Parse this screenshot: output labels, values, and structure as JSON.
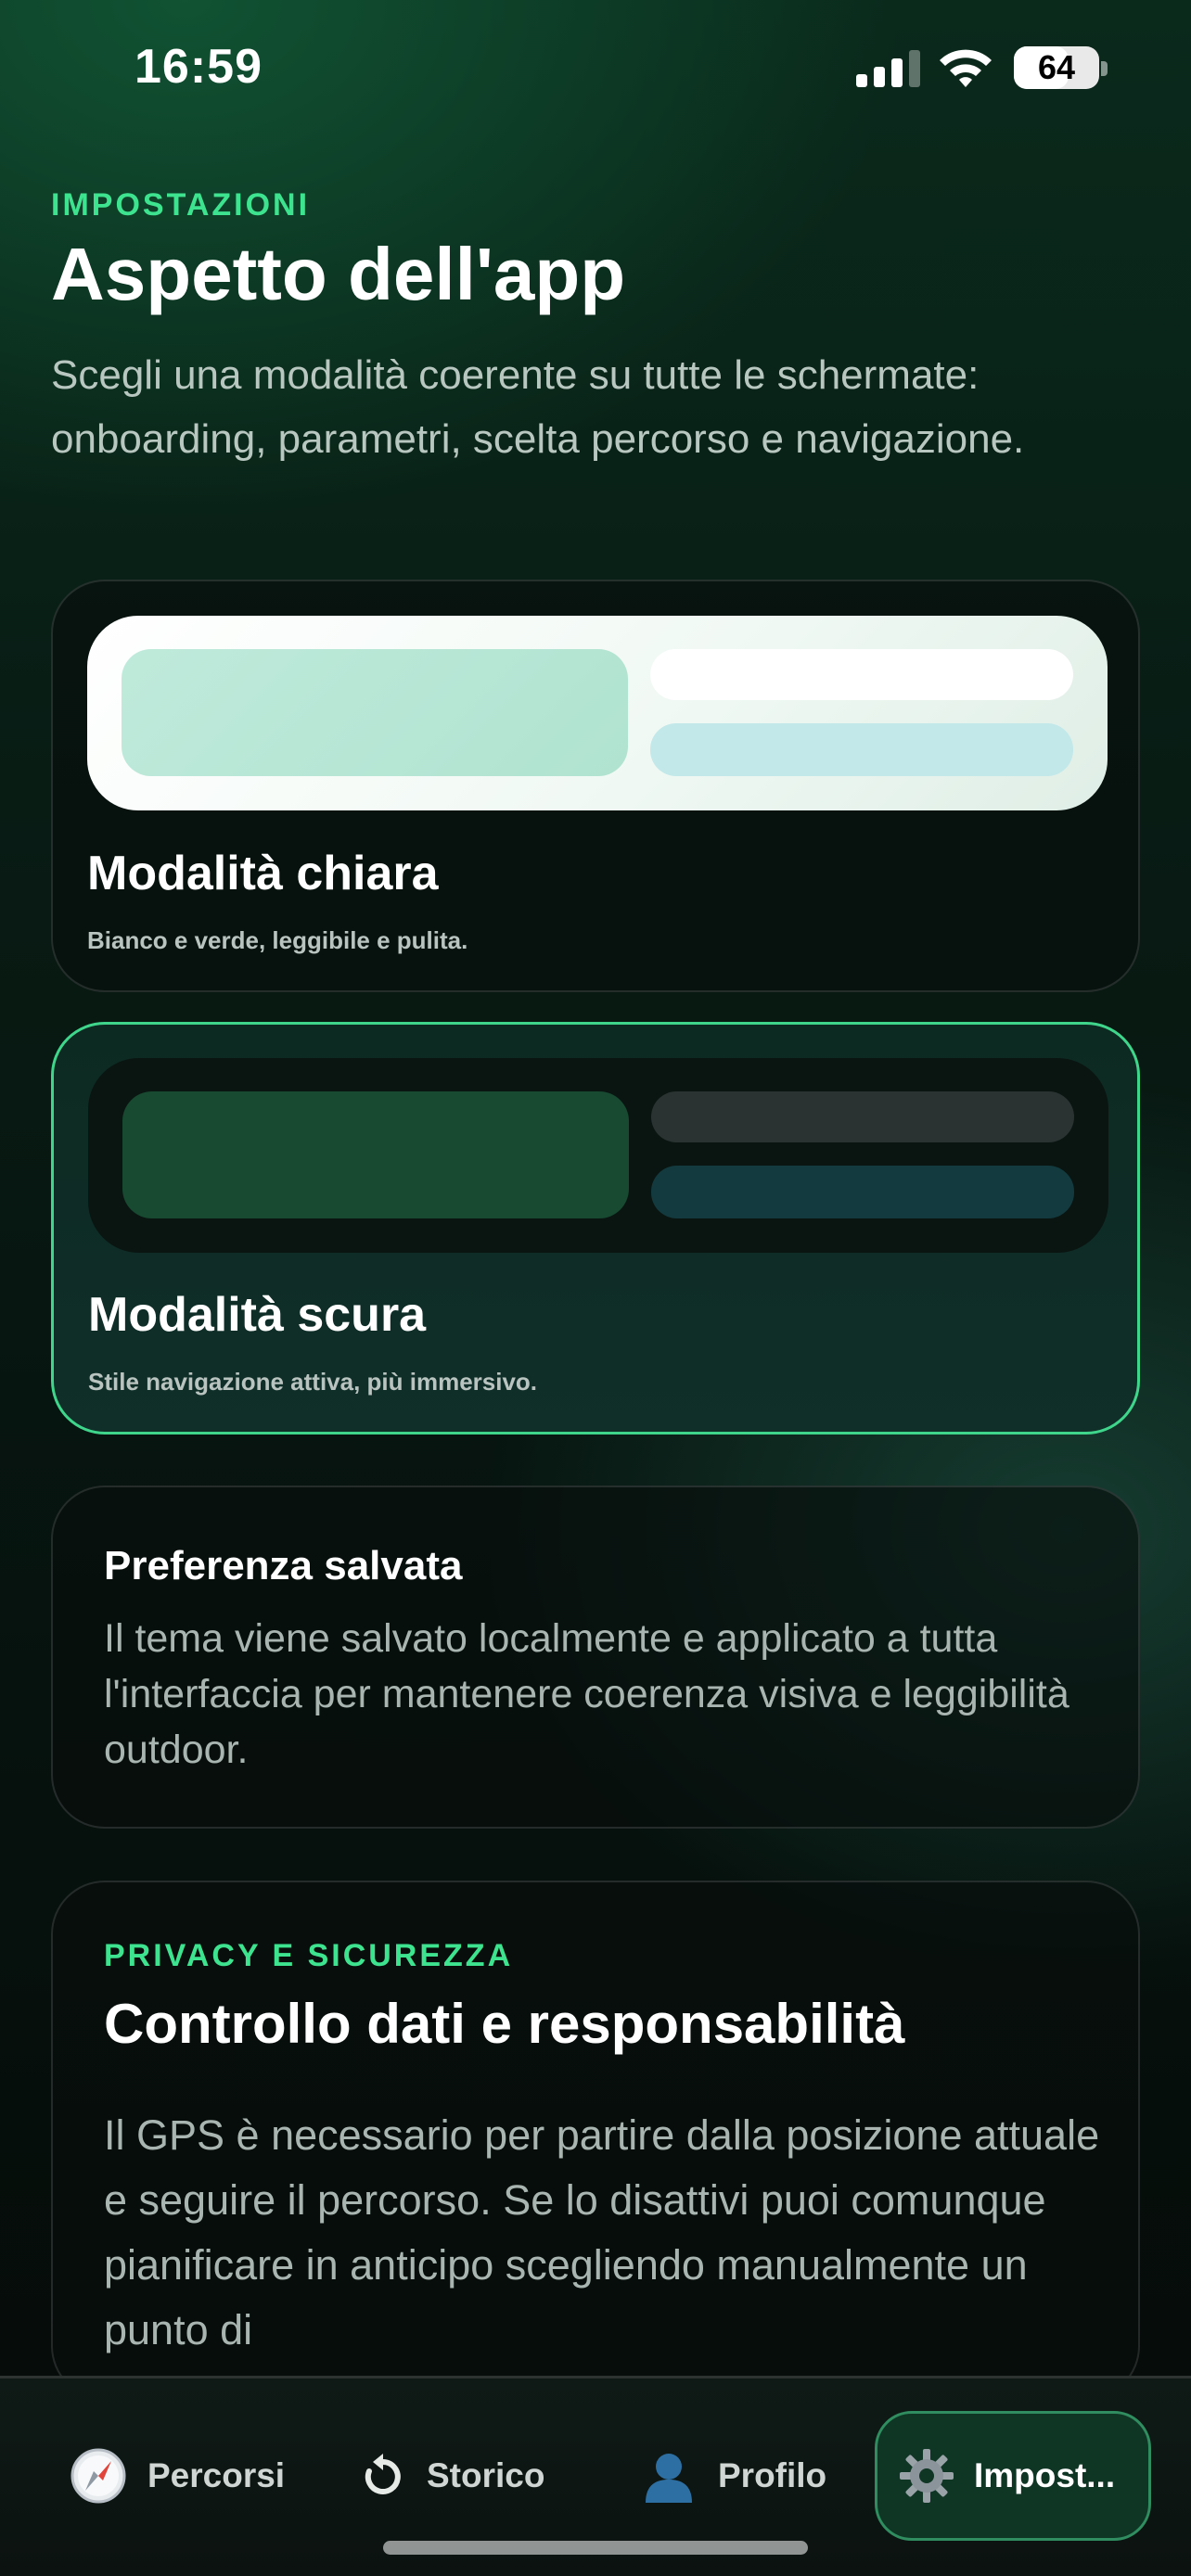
{
  "status_bar": {
    "time": "16:59",
    "battery": "64",
    "battery_level": 0.64
  },
  "header": {
    "eyebrow": "IMPOSTAZIONI",
    "title": "Aspetto dell'app",
    "subtitle": "Scegli una modalità coerente su tutte le schermate: onboarding, parametri, scelta percorso e navigazione."
  },
  "themes": [
    {
      "title": "Modalità chiara",
      "description": "Bianco e verde, leggibile e pulita.",
      "selected": false
    },
    {
      "title": "Modalità scura",
      "description": "Stile navigazione attiva, più immersivo.",
      "selected": true
    }
  ],
  "saved_pref": {
    "title": "Preferenza salvata",
    "text": "Il tema viene salvato localmente e applicato a tutta l'interfaccia per mantenere coerenza visiva e leggibilità outdoor."
  },
  "privacy": {
    "eyebrow": "PRIVACY E SICUREZZA",
    "title": "Controllo dati e responsabilità",
    "text": "Il GPS è necessario per partire dalla posizione attuale e seguire il percorso. Se lo disattivi puoi comunque pianificare in anticipo scegliendo manualmente un punto di"
  },
  "tabs": [
    {
      "label": "Percorsi",
      "icon": "compass-icon"
    },
    {
      "label": "Storico",
      "icon": "history-icon"
    },
    {
      "label": "Profilo",
      "icon": "profile-icon"
    },
    {
      "label": "Impost...",
      "icon": "gear-icon",
      "active": true
    }
  ],
  "colors": {
    "accent": "#3ee38f",
    "selected_border": "#3fd68c"
  }
}
